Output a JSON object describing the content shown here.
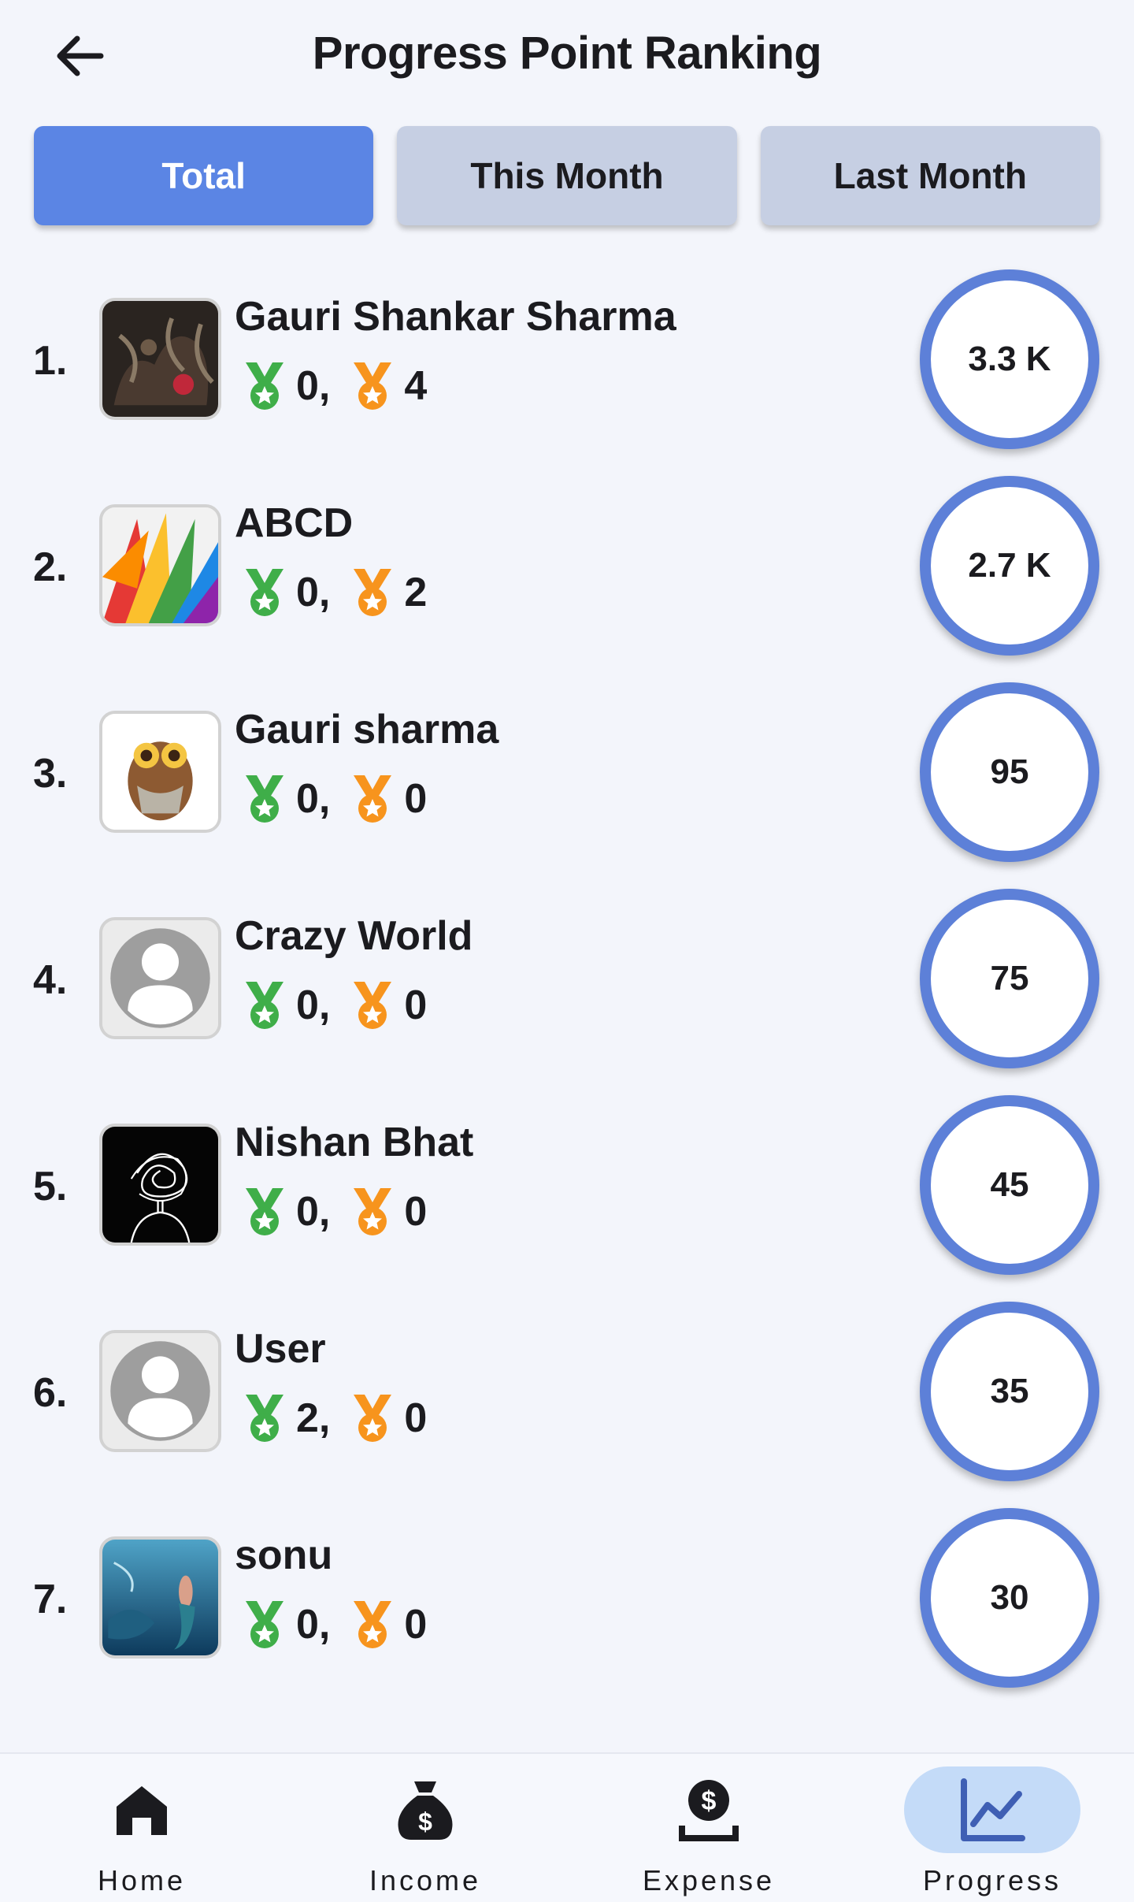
{
  "header": {
    "title": "Progress Point Ranking",
    "back_icon": "arrow-left-icon"
  },
  "tabs": [
    {
      "label": "Total",
      "active": true
    },
    {
      "label": "This Month",
      "active": false
    },
    {
      "label": "Last Month",
      "active": false
    }
  ],
  "medal_colors": {
    "green": "#3fae49",
    "orange": "#f7941d"
  },
  "accent": "#5b85e4",
  "ranking": [
    {
      "rank": "1.",
      "name": "Gauri Shankar Sharma",
      "green_count": "0,",
      "orange_count": "4",
      "score": "3.3 K",
      "avatar": "photo-dark-spider"
    },
    {
      "rank": "2.",
      "name": "ABCD",
      "green_count": "0,",
      "orange_count": "2",
      "score": "2.7 K",
      "avatar": "photo-colorful-feathers"
    },
    {
      "rank": "3.",
      "name": "Gauri sharma",
      "green_count": "0,",
      "orange_count": "0",
      "score": "95",
      "avatar": "photo-owl"
    },
    {
      "rank": "4.",
      "name": "Crazy World",
      "green_count": "0,",
      "orange_count": "0",
      "score": "75",
      "avatar": "default-person"
    },
    {
      "rank": "5.",
      "name": "Nishan Bhat",
      "green_count": "0,",
      "orange_count": "0",
      "score": "45",
      "avatar": "sketch-scribble-head"
    },
    {
      "rank": "6.",
      "name": "User",
      "green_count": "2,",
      "orange_count": "0",
      "score": "35",
      "avatar": "default-person"
    },
    {
      "rank": "7.",
      "name": "sonu",
      "green_count": "0,",
      "orange_count": "0",
      "score": "30",
      "avatar": "photo-underwater"
    }
  ],
  "bottom_nav": [
    {
      "label": "Home",
      "icon": "home-icon",
      "active": false
    },
    {
      "label": "Income",
      "icon": "money-bag-icon",
      "active": false
    },
    {
      "label": "Expense",
      "icon": "expense-icon",
      "active": false
    },
    {
      "label": "Progress",
      "icon": "chart-line-icon",
      "active": true
    }
  ]
}
